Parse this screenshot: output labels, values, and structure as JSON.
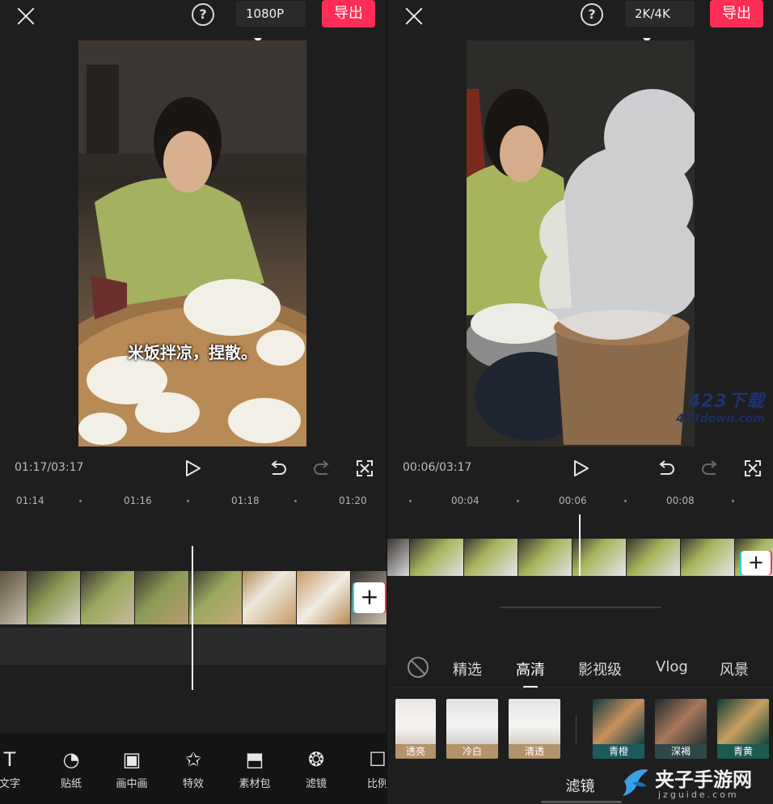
{
  "left": {
    "resolution": "1080P",
    "export_label": "导出",
    "subtitle": "米饭拌凉，捏散。",
    "timecode": "01:17/03:17",
    "ruler": [
      "01:14",
      "01:16",
      "01:18",
      "01:20"
    ],
    "tools": [
      {
        "label": "文字",
        "icon": "text-icon"
      },
      {
        "label": "贴纸",
        "icon": "sticker-icon"
      },
      {
        "label": "画中画",
        "icon": "picture-in-picture-icon"
      },
      {
        "label": "特效",
        "icon": "effects-icon"
      },
      {
        "label": "素材包",
        "icon": "material-pack-icon"
      },
      {
        "label": "滤镜",
        "icon": "filter-icon"
      },
      {
        "label": "比例",
        "icon": "ratio-icon"
      }
    ]
  },
  "right": {
    "resolution": "2K/4K",
    "export_label": "导出",
    "timecode": "00:06/03:17",
    "ruler": [
      "00:04",
      "00:06",
      "00:08"
    ],
    "categories": [
      "精选",
      "高清",
      "影视级",
      "Vlog",
      "风景"
    ],
    "active_category": "高清",
    "filters": [
      "透亮",
      "冷白",
      "清透",
      "青橙",
      "深褐",
      "青黄"
    ],
    "panel_title": "滤镜"
  },
  "watermarks": {
    "site1_logo": "423下载",
    "site1_url": "423down.com",
    "site2_name": "夹子手游网",
    "site2_url": "jzguide.com"
  },
  "colors": {
    "accent": "#fd2d55",
    "background": "#1e1e1e"
  }
}
